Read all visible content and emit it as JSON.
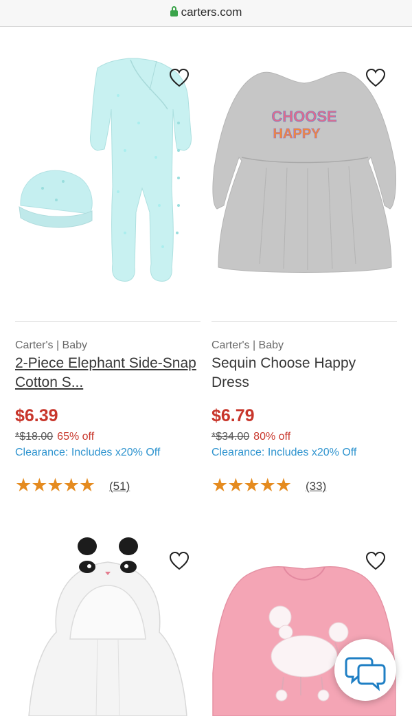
{
  "browser": {
    "url": "carters.com"
  },
  "products": [
    {
      "brand": "Carter's | Baby",
      "name": "2-Piece Elephant Side-Snap Cotton S...",
      "price": "$6.39",
      "was": "*$18.00",
      "off": "65% off",
      "clearance": "Clearance: Includes x20% Off",
      "stars": "★★★★★",
      "rating_count": "(51)"
    },
    {
      "brand": "Carter's | Baby",
      "name": "Sequin Choose Happy Dress",
      "price": "$6.79",
      "was": "*$34.00",
      "off": "80% off",
      "clearance": "Clearance: Includes x20% Off",
      "stars": "★★★★★",
      "rating_count": "(33)"
    }
  ],
  "graphics": {
    "dress_text_line1": "CHOOSE",
    "dress_text_line2": "HAPPY"
  },
  "icons": {
    "lock": "lock-icon",
    "heart": "heart-outline-icon",
    "chat": "chat-bubbles-icon"
  },
  "colors": {
    "price_red": "#c8362b",
    "clearance_blue": "#2f94cf",
    "star_orange": "#e58b1f",
    "lock_green": "#3aa34a"
  }
}
